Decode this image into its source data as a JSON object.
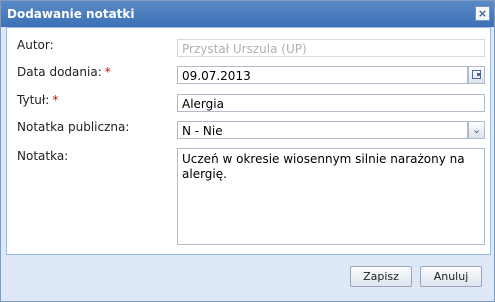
{
  "dialog": {
    "title": "Dodawanie notatki",
    "close_icon": "×"
  },
  "form": {
    "author": {
      "label": "Autor:",
      "value": "Przystał Urszula  (UP)"
    },
    "date_added": {
      "label": "Data dodania:",
      "required": "*",
      "value": "09.07.2013"
    },
    "title": {
      "label": "Tytuł:",
      "required": "*",
      "value": "Alergia"
    },
    "public_note": {
      "label": "Notatka publiczna:",
      "value": "N - Nie"
    },
    "note": {
      "label": "Notatka:",
      "value": "Uczeń w okresie wiosennym silnie narażony na alergię."
    }
  },
  "footer": {
    "save_label": "Zapisz",
    "cancel_label": "Anuluj"
  },
  "colors": {
    "titlebar": "#3d71b5",
    "panel": "#dfe8f6",
    "required": "#dd0000"
  }
}
